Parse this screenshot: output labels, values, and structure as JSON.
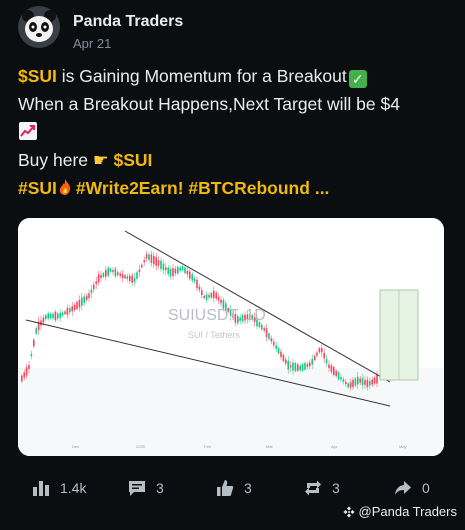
{
  "post": {
    "author": "Panda Traders",
    "date": "Apr 21",
    "line1_ticker": "$SUI",
    "line1_text": " is Gaining Momentum for a Breakout",
    "line2_text": "When a Breakout Happens,Next Target will be $4",
    "line4_text": "Buy here ",
    "line4_ticker": "$SUI",
    "hashtag1": "#SUI",
    "hashtag2": "#Write2Earn!",
    "hashtag3": "#BTCRebound",
    "more": "..."
  },
  "chart": {
    "watermark_title": "SUIUSDT, 1D",
    "watermark_subtitle": "SUI / Tethers",
    "box_label": "",
    "x_ticks": [
      "Dec",
      "2025",
      "Feb",
      "Mar",
      "Apr",
      "May"
    ],
    "credit": ""
  },
  "actions": {
    "views": "1.4k",
    "comments": "3",
    "likes": "3",
    "reposts": "3",
    "shares": "0"
  },
  "footer": {
    "watermark": "@Panda Traders"
  },
  "icons": {
    "avatar": "panda-avatar",
    "views": "bar-chart-icon",
    "comments": "comment-icon",
    "likes": "thumbs-up-icon",
    "reposts": "repost-icon",
    "shares": "share-icon"
  },
  "colors": {
    "background": "#0b0e11",
    "accent": "#f0b90b",
    "muted": "#848e9c",
    "candle_up": "#0ecb81",
    "candle_down": "#f6465d"
  }
}
